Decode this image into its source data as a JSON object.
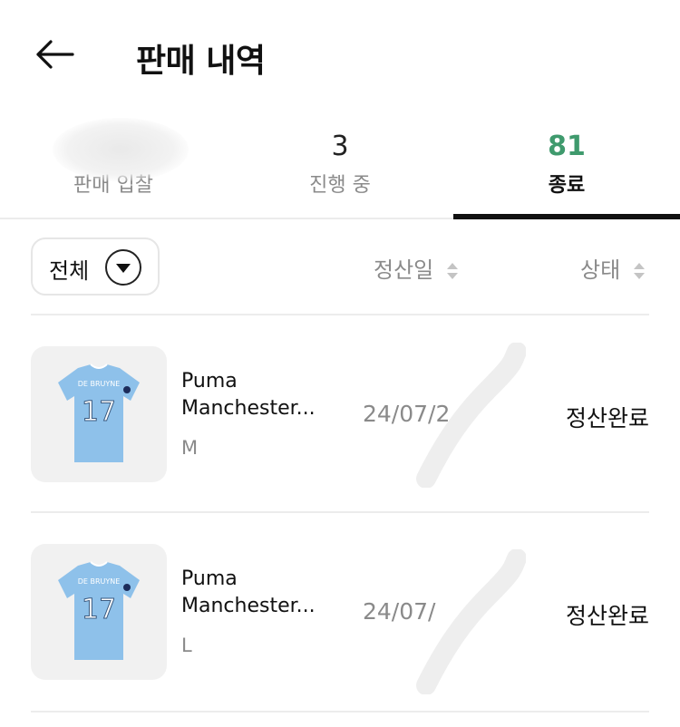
{
  "header": {
    "title": "판매 내역",
    "back_icon": "arrow-left-icon"
  },
  "tabs": [
    {
      "count": "",
      "label": "판매 입찰"
    },
    {
      "count": "3",
      "label": "진행 중"
    },
    {
      "count": "81",
      "label": "종료"
    }
  ],
  "filter": {
    "label": "전체",
    "icon": "triangle-down-icon"
  },
  "sort": {
    "settlement_label": "정산일",
    "status_label": "상태",
    "icon": "sort-icon"
  },
  "items": [
    {
      "brand": "Puma",
      "name": "Manchester...",
      "size": "M",
      "date": "24/07/2",
      "status": "정산완료",
      "jersey_name": "DE BRUYNE",
      "jersey_number": "17"
    },
    {
      "brand": "Puma",
      "name": "Manchester...",
      "size": "L",
      "date": "24/07/",
      "status": "정산완료",
      "jersey_name": "DE BRUYNE",
      "jersey_number": "17"
    }
  ],
  "colors": {
    "accent": "#3f9a6d",
    "jersey": "#8ec1ea",
    "text_muted": "#8a8a8a",
    "divider": "#ececec"
  }
}
